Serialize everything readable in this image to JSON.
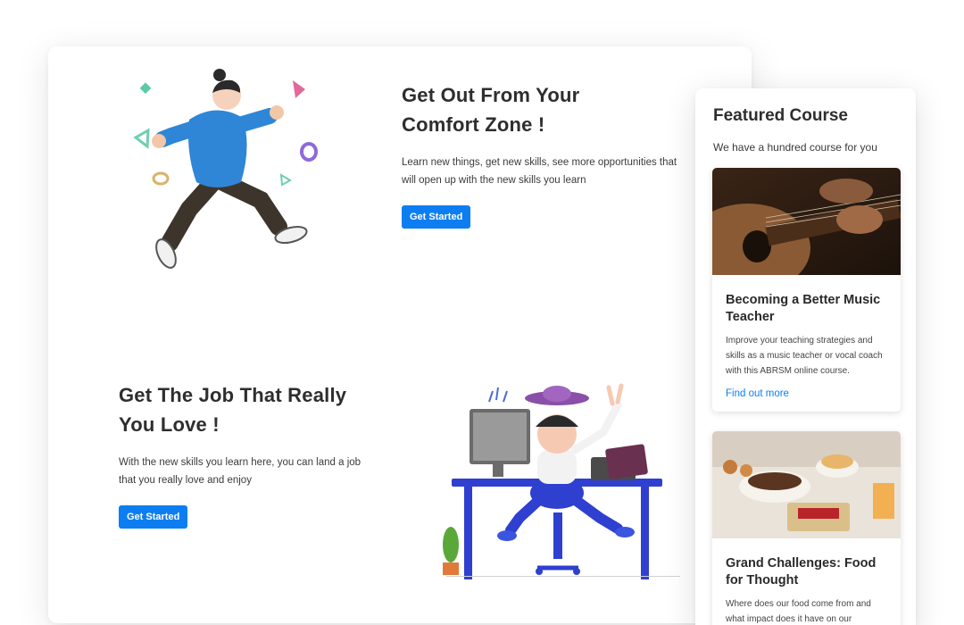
{
  "hero": {
    "title_line1": "Get Out From Your",
    "title_line2": "Comfort Zone !",
    "description": "Learn new things, get new skills, see more opportunities that will open up with the new skills you learn",
    "cta_label": "Get Started"
  },
  "job": {
    "title_line1": "Get The Job That Really",
    "title_line2": "You Love !",
    "description": "With the new skills you learn here, you can land a job that you really love and enjoy",
    "cta_label": "Get Started"
  },
  "featured": {
    "title": "Featured Course",
    "subtitle": "We have a hundred course for you",
    "courses": [
      {
        "title": "Becoming a Better Music Teacher",
        "description": "Improve your teaching strategies and skills as a music teacher or vocal coach with this ABRSM online course.",
        "link_label": "Find out more",
        "image": "guitar-photo"
      },
      {
        "title": "Grand Challenges: Food for Thought",
        "description": "Where does our food come from and what impact does it have on our",
        "image": "food-photo"
      }
    ]
  },
  "colors": {
    "accent": "#0d7ef2",
    "text": "#2e2e2e"
  }
}
